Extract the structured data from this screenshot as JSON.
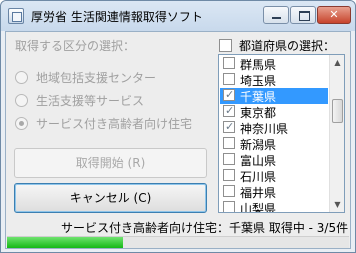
{
  "window": {
    "title": "厚労省 生活関連情報取得ソフト"
  },
  "left": {
    "group_label": "取得する区分の選択：",
    "radios": [
      {
        "label": "地域包括支援センター",
        "checked": false
      },
      {
        "label": "生活支援等サービス",
        "checked": false
      },
      {
        "label": "サービス付き高齢者向け住宅",
        "checked": true
      }
    ],
    "start_button": "取得開始 (R)",
    "cancel_button": "キャンセル (C)"
  },
  "right": {
    "select_all_label": "都道府県の選択：",
    "prefectures": [
      {
        "label": "群馬県",
        "checked": false,
        "selected": false
      },
      {
        "label": "埼玉県",
        "checked": false,
        "selected": false
      },
      {
        "label": "千葉県",
        "checked": true,
        "selected": true
      },
      {
        "label": "東京都",
        "checked": true,
        "selected": false
      },
      {
        "label": "神奈川県",
        "checked": true,
        "selected": false
      },
      {
        "label": "新潟県",
        "checked": false,
        "selected": false
      },
      {
        "label": "富山県",
        "checked": false,
        "selected": false
      },
      {
        "label": "石川県",
        "checked": false,
        "selected": false
      },
      {
        "label": "福井県",
        "checked": false,
        "selected": false
      },
      {
        "label": "山梨県",
        "checked": false,
        "selected": false
      }
    ]
  },
  "status": {
    "text": "サービス付き高齢者向け住宅：千葉県 取得中 - 3/5件",
    "progress": 0.34
  }
}
